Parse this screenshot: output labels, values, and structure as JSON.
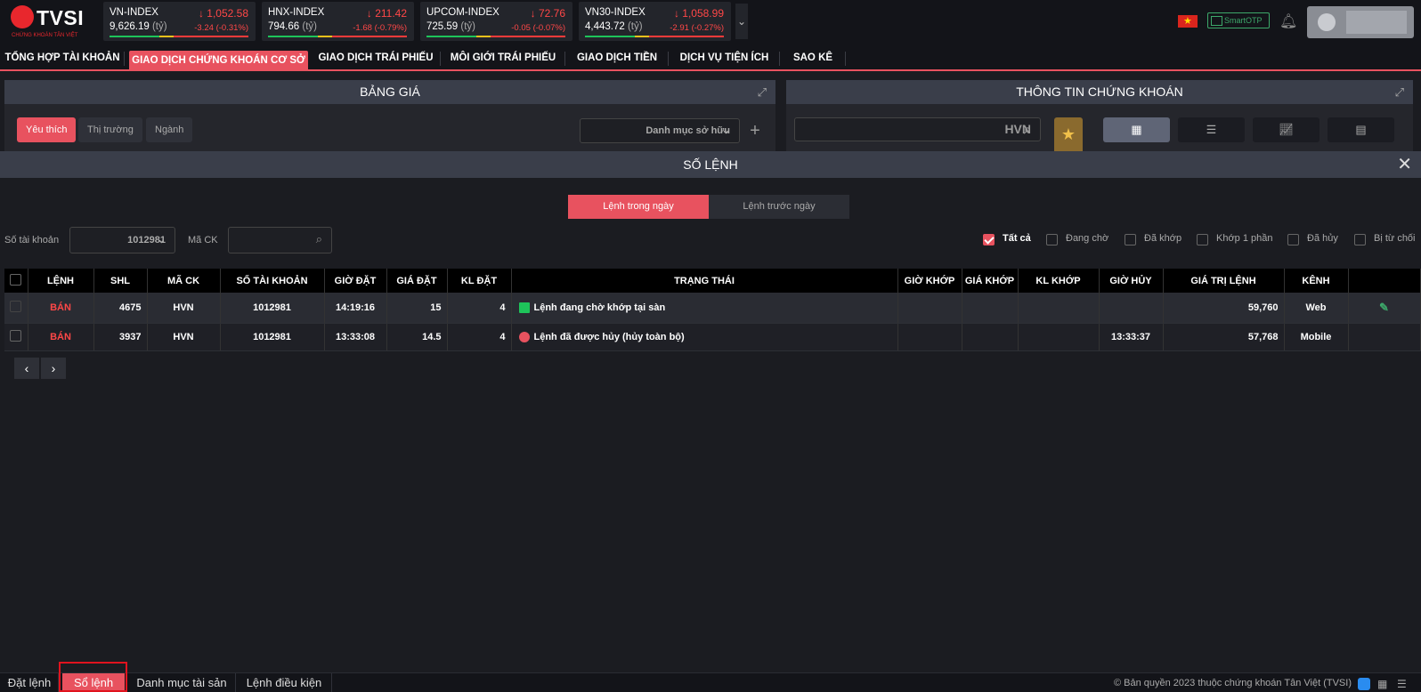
{
  "brand": {
    "name": "TVSI",
    "tagline": "CHỨNG KHOÁN TÂN VIỆT"
  },
  "indices": [
    {
      "name": "VN-INDEX",
      "value": "9,626.19",
      "unit": "(tỷ)",
      "price": "1,052.58",
      "change": "-3.24",
      "pct": "(-0.31%)"
    },
    {
      "name": "HNX-INDEX",
      "value": "794.66",
      "unit": "(tỷ)",
      "price": "211.42",
      "change": "-1.68",
      "pct": "(-0.79%)"
    },
    {
      "name": "UPCOM-INDEX",
      "value": "725.59",
      "unit": "(tỷ)",
      "price": "72.76",
      "change": "-0.05",
      "pct": "(-0.07%)"
    },
    {
      "name": "VN30-INDEX",
      "value": "4,443.72",
      "unit": "(tỷ)",
      "price": "1,058.99",
      "change": "-2.91",
      "pct": "(-0.27%)"
    }
  ],
  "otp_label": "SmartOTP",
  "nav": [
    "TỔNG HỢP TÀI KHOẢN",
    "GIAO DỊCH CHỨNG KHOÁN CƠ SỞ",
    "GIAO DỊCH TRÁI PHIẾU",
    "MÔI GIỚI TRÁI PHIẾU",
    "GIAO DỊCH TIỀN",
    "DỊCH VỤ TIỆN ÍCH",
    "SAO KÊ"
  ],
  "price_board": {
    "title": "BẢNG GIÁ",
    "chips": [
      "Yêu thích",
      "Thị trường",
      "Ngành"
    ],
    "list": "Danh mục sở hữu"
  },
  "stock_info": {
    "title": "THÔNG TIN CHỨNG KHOÁN",
    "search_value": "HVN"
  },
  "order_book": {
    "title": "SỐ LỆNH",
    "tabs": [
      "Lệnh trong ngày",
      "Lệnh trước ngày"
    ],
    "account_label": "Số tài khoản",
    "account_value": "1012981",
    "symbol_label": "Mã CK",
    "filters": [
      "Tất cả",
      "Đang chờ",
      "Đã khớp",
      "Khớp 1 phần",
      "Đã hủy",
      "Bị từ chối"
    ],
    "columns": [
      "LỆNH",
      "SHL",
      "MÃ CK",
      "SỐ TÀI KHOẢN",
      "GIỜ ĐẶT",
      "GIÁ ĐẶT",
      "KL ĐẶT",
      "TRẠNG THÁI",
      "GIỜ KHỚP",
      "GIÁ KHỚP",
      "KL KHỚP",
      "GIỜ HỦY",
      "GIÁ TRỊ LỆNH",
      "KÊNH"
    ],
    "rows": [
      {
        "side": "BÁN",
        "shl": "4675",
        "symbol": "HVN",
        "account": "1012981",
        "time": "14:19:16",
        "price": "15",
        "qty": "4",
        "status": "Lệnh đang chờ khớp tại sàn",
        "match_time": "",
        "match_price": "",
        "match_qty": "",
        "cancel_time": "",
        "value": "59,760",
        "channel": "Web"
      },
      {
        "side": "BÁN",
        "shl": "3937",
        "symbol": "HVN",
        "account": "1012981",
        "time": "13:33:08",
        "price": "14.5",
        "qty": "4",
        "status": "Lệnh đã được hủy (hủy toàn bộ)",
        "match_time": "",
        "match_price": "",
        "match_qty": "",
        "cancel_time": "13:33:37",
        "value": "57,768",
        "channel": "Mobile"
      }
    ]
  },
  "footer": {
    "tabs": [
      "Đặt lệnh",
      "Sổ lệnh",
      "Danh mục tài sản",
      "Lệnh điều kiện"
    ],
    "copyright": "© Bản quyền 2023 thuộc chứng khoán Tân Việt (TVSI)"
  }
}
